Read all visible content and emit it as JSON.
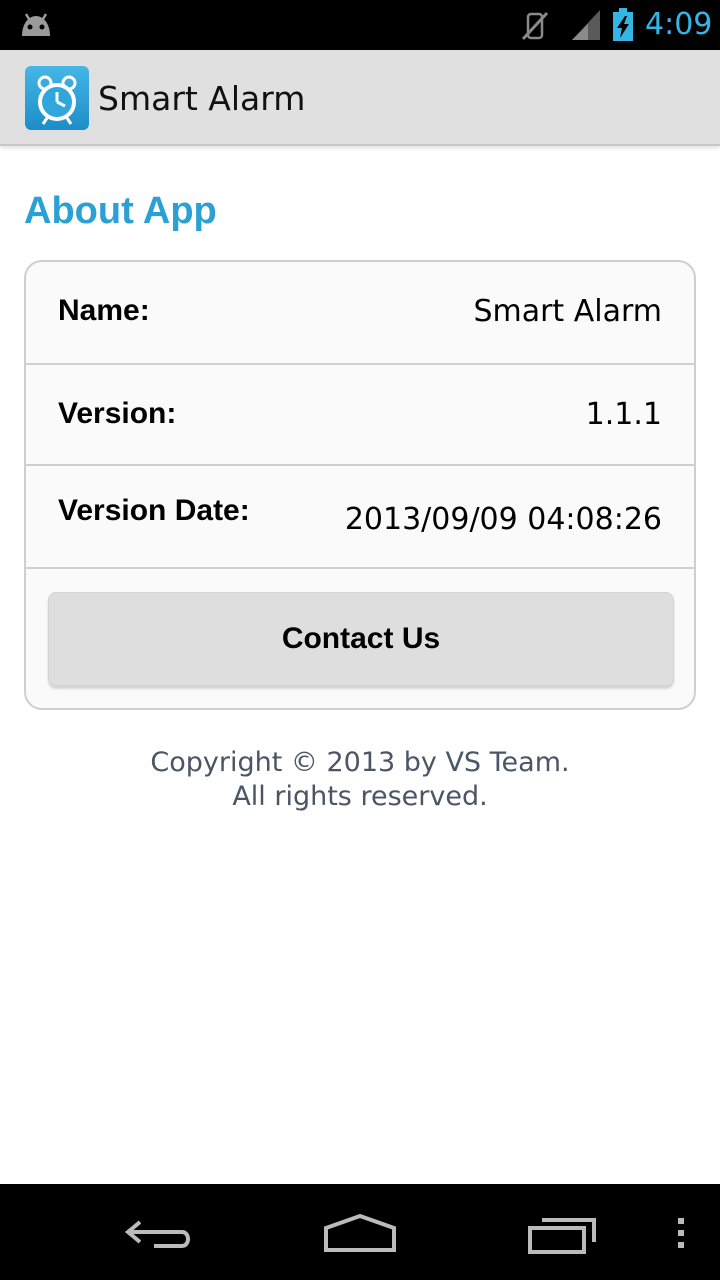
{
  "status_bar": {
    "time": "4:09",
    "icons": [
      "android-debug-icon",
      "mute-icon",
      "signal-icon",
      "battery-charging-icon"
    ],
    "accent_color": "#33b5e5"
  },
  "action_bar": {
    "title": "Smart Alarm",
    "icon": "alarm-clock-icon"
  },
  "about": {
    "title": "About App",
    "rows": [
      {
        "label": "Name:",
        "value": "Smart Alarm"
      },
      {
        "label": "Version:",
        "value": "1.1.1"
      },
      {
        "label": "Version Date:",
        "value": "2013/09/09 04:08:26"
      }
    ],
    "contact_label": "Contact Us"
  },
  "footer": {
    "copyright_line1": "Copyright © 2013 by VS Team.",
    "copyright_line2": "All rights reserved."
  },
  "nav_bar": {
    "icons": [
      "back-icon",
      "home-icon",
      "recent-apps-icon",
      "menu-icon"
    ]
  },
  "colors": {
    "title_accent": "#2ba0d5",
    "action_bar_bg": "#e0e0e0",
    "button_bg": "#dedede"
  }
}
